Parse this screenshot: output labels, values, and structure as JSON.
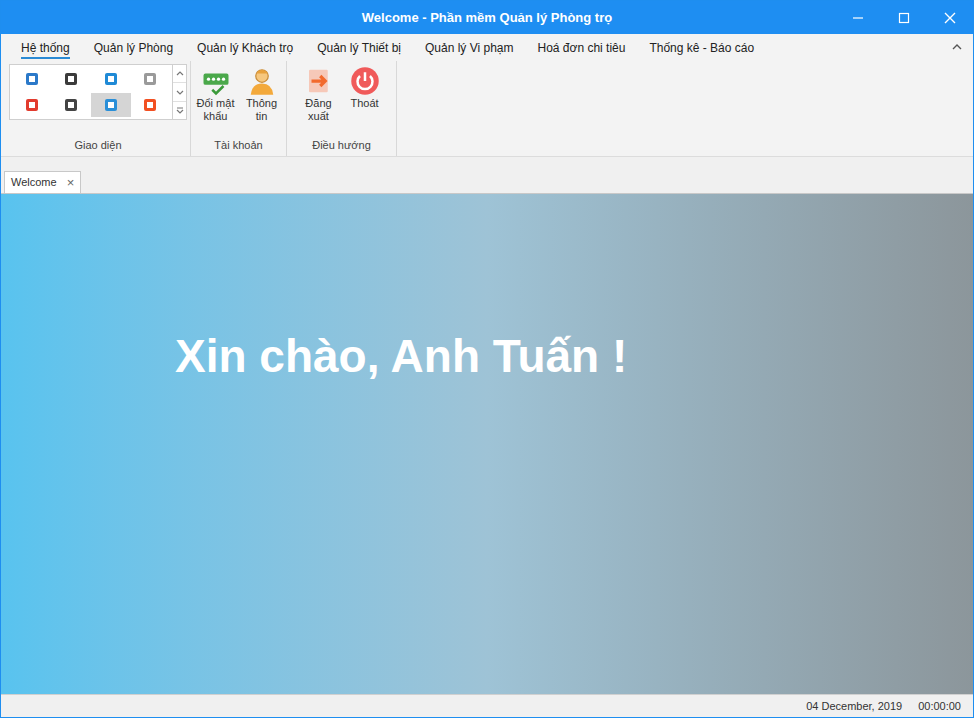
{
  "window": {
    "title": "Welcome - Phần mềm Quản lý Phòng trọ"
  },
  "ribbon": {
    "tabs": [
      {
        "label": "Hệ thống",
        "selected": true
      },
      {
        "label": "Quản lý Phòng",
        "selected": false
      },
      {
        "label": "Quản lý Khách trọ",
        "selected": false
      },
      {
        "label": "Quản lý Thiết bị",
        "selected": false
      },
      {
        "label": "Quản lý Vi phạm",
        "selected": false
      },
      {
        "label": "Hoá đơn chi tiêu",
        "selected": false
      },
      {
        "label": "Thống kê - Báo cáo",
        "selected": false
      }
    ],
    "skins_group": {
      "label": "Giao diện",
      "skins": [
        {
          "selected": false,
          "color": "#2b79c9"
        },
        {
          "selected": false,
          "color": "#3b3b3b"
        },
        {
          "selected": false,
          "color": "#1f8ad6"
        },
        {
          "selected": false,
          "color": "#9a9a9a"
        },
        {
          "selected": false,
          "color": "#e23b2e"
        },
        {
          "selected": false,
          "color": "#444444"
        },
        {
          "selected": true,
          "color": "#2a8fd8"
        },
        {
          "selected": false,
          "color": "#f25022"
        }
      ]
    },
    "account_group": {
      "label": "Tài khoản",
      "buttons": [
        {
          "label": "Đổi mật khẩu",
          "kind": "key"
        },
        {
          "label": "Thông tin",
          "kind": "user"
        }
      ]
    },
    "nav_group": {
      "label": "Điều hướng",
      "buttons": [
        {
          "label": "Đăng xuất",
          "kind": "logout"
        },
        {
          "label": "Thoát",
          "kind": "power"
        }
      ]
    }
  },
  "document_tabs": [
    {
      "label": "Welcome",
      "close": "×",
      "selected": true
    }
  ],
  "welcome": {
    "greeting": "Xin chào, Anh Tuấn !"
  },
  "status_bar": {
    "date": "04 December, 2019",
    "time": "00:00:00"
  }
}
